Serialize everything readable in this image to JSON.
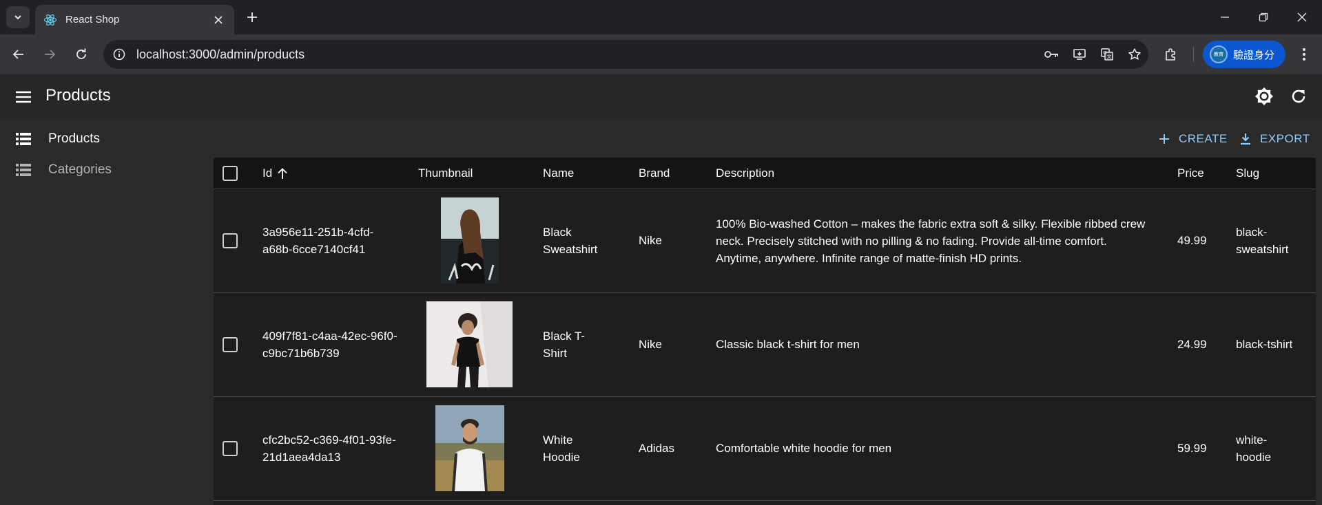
{
  "browser": {
    "tab_title": "React Shop",
    "url": "localhost:3000/admin/products",
    "profile_label": "驗證身分",
    "profile_avatar_text": "教育"
  },
  "app": {
    "title": "Products"
  },
  "sidebar": {
    "items": [
      {
        "label": "Products",
        "icon": "list-icon",
        "active": true
      },
      {
        "label": "Categories",
        "icon": "list-icon",
        "active": false
      }
    ]
  },
  "actions": {
    "create_label": "CREATE",
    "export_label": "EXPORT"
  },
  "table": {
    "columns": [
      "Id",
      "Thumbnail",
      "Name",
      "Brand",
      "Description",
      "Price",
      "Slug"
    ],
    "sort_column": "Id",
    "sort_direction": "ascending",
    "rows": [
      {
        "id": "3a956e11-251b-4cfd-a68b-6cce7140cf41",
        "thumbnail": "woman-in-graphic-sweatshirt-photo",
        "name": "Black Sweatshirt",
        "brand": "Nike",
        "description": "100% Bio-washed Cotton – makes the fabric extra soft & silky. Flexible ribbed crew neck. Precisely stitched with no pilling & no fading. Provide all-time comfort. Anytime, anywhere. Infinite range of matte-finish HD prints.",
        "price": "49.99",
        "slug": "black-sweatshirt"
      },
      {
        "id": "409f7f81-c4aa-42ec-96f0-c9bc71b6b739",
        "thumbnail": "man-in-black-tshirt-photo",
        "name": "Black T-Shirt",
        "brand": "Nike",
        "description": "Classic black t-shirt for men",
        "price": "24.99",
        "slug": "black-tshirt"
      },
      {
        "id": "cfc2bc52-c369-4f01-93fe-21d1aea4da13",
        "thumbnail": "man-in-white-hoodie-photo",
        "name": "White Hoodie",
        "brand": "Adidas",
        "description": "Comfortable white hoodie for men",
        "price": "59.99",
        "slug": "white-hoodie"
      }
    ]
  },
  "colors": {
    "accent": "#90caf9",
    "profile_button": "#0b57d0"
  }
}
